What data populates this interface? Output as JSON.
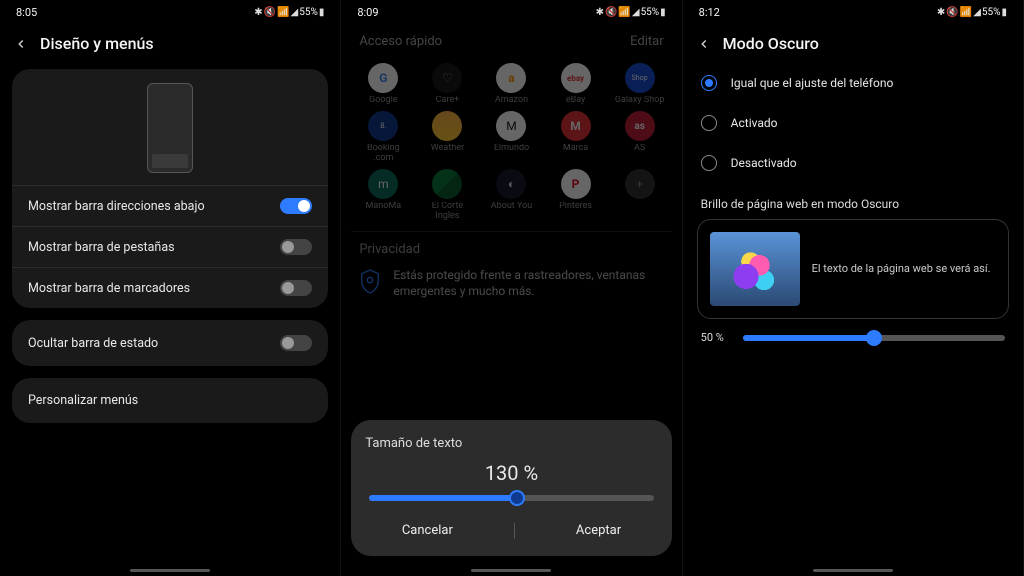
{
  "status": {
    "times": {
      "s1": "8:05",
      "s2": "8:09",
      "s3": "8:12"
    },
    "battery": "55%",
    "indicators": "✱ ✕ ⚲ ◢"
  },
  "s1": {
    "title": "Diseño y menús",
    "rows": [
      {
        "label": "Mostrar barra direcciones abajo",
        "value": true
      },
      {
        "label": "Mostrar barra de pestañas",
        "value": false
      },
      {
        "label": "Mostrar barra de marcadores",
        "value": false
      }
    ],
    "hide_status": "Ocultar barra de estado",
    "customize": "Personalizar menús"
  },
  "s2": {
    "quick_access": "Acceso rápido",
    "edit": "Editar",
    "tiles": [
      {
        "label": "Google",
        "ico": "G",
        "cls": "ico-google"
      },
      {
        "label": "Care+",
        "ico": "♡",
        "cls": "ico-care"
      },
      {
        "label": "Amazon",
        "ico": "a",
        "cls": "ico-amazon"
      },
      {
        "label": "eBay",
        "ico": "ebay",
        "cls": "ico-ebay"
      },
      {
        "label": "Galaxy Shop",
        "ico": "Shop",
        "cls": "ico-galaxy"
      },
      {
        "label": "Booking .com",
        "ico": "B.",
        "cls": "ico-booking"
      },
      {
        "label": "Weather",
        "ico": "",
        "cls": "ico-weather"
      },
      {
        "label": "Elmundo",
        "ico": "M",
        "cls": "ico-mundo"
      },
      {
        "label": "Marca",
        "ico": "M",
        "cls": "ico-marca"
      },
      {
        "label": "AS",
        "ico": "as",
        "cls": "ico-as"
      },
      {
        "label": "ManoMa",
        "ico": "m",
        "cls": "ico-mm"
      },
      {
        "label": "El Corte Ingles",
        "ico": "",
        "cls": "ico-eci"
      },
      {
        "label": "About You",
        "ico": "◐",
        "cls": "ico-ay"
      },
      {
        "label": "Pinteres",
        "ico": "P",
        "cls": "ico-pint"
      },
      {
        "label": "",
        "ico": "+",
        "cls": "ico-plus"
      }
    ],
    "privacy": "Privacidad",
    "privacy_text": "Estás protegido frente a rastreadores, ventanas emergentes y mucho más.",
    "modal": {
      "title": "Tamaño de texto",
      "value": "130 %",
      "percent": 52,
      "cancel": "Cancelar",
      "accept": "Aceptar"
    }
  },
  "s3": {
    "title": "Modo Oscuro",
    "options": [
      {
        "label": "Igual que el ajuste del teléfono",
        "checked": true
      },
      {
        "label": "Activado",
        "checked": false
      },
      {
        "label": "Desactivado",
        "checked": false
      }
    ],
    "brightness_section": "Brillo de página web en modo Oscuro",
    "preview_text": "El texto de la página web se verá así.",
    "brightness": {
      "pct_label": "50 %",
      "pct": 50
    }
  }
}
